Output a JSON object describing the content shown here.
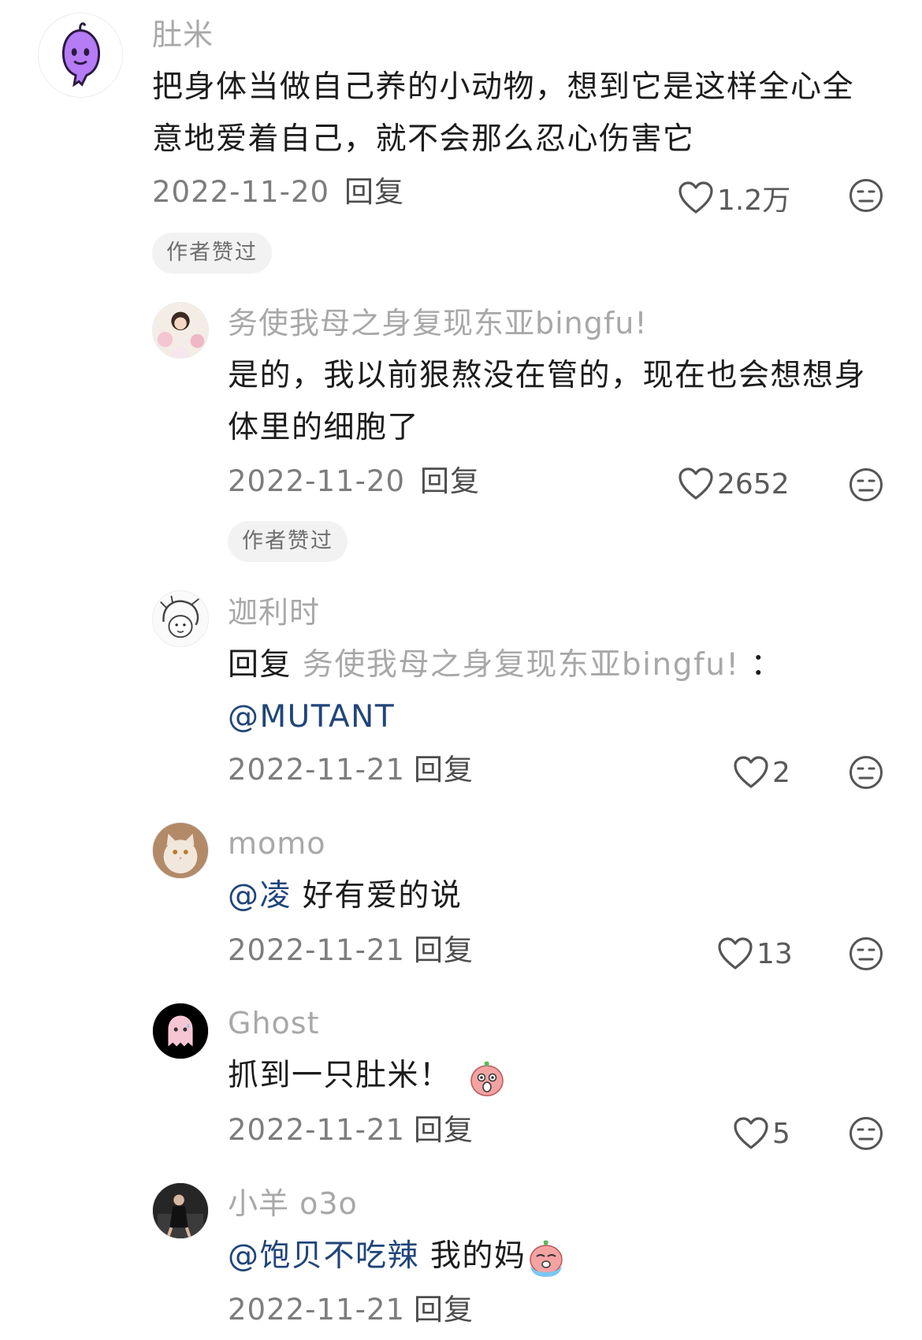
{
  "comments": [
    {
      "username": "肚米",
      "text_lines": [
        "把身体当做自己养的小动物，想到它是这样全心全",
        "意地爱着自己，就不会那么忍心伤害它"
      ],
      "date": "2022-11-20",
      "reply_label": "回复",
      "likes": "1.2万",
      "badge": "作者赞过",
      "avatar_color": "#b57cf5"
    },
    {
      "username": "务使我母之身复现东亚bingfu!",
      "text_lines": [
        "是的，我以前狠熬没在管的，现在也会想想身",
        "体里的细胞了"
      ],
      "date": "2022-11-20",
      "reply_label": "回复",
      "likes": "2652",
      "badge": "作者赞过"
    },
    {
      "username": "迦利时",
      "reply_prefix": "回复",
      "reply_to": "务使我母之身复现东亚bingfu!",
      "reply_colon": "：",
      "mention": "@MUTANT",
      "date": "2022-11-21",
      "reply_label": "回复",
      "likes": "2"
    },
    {
      "username": "momo",
      "mention": "@凌",
      "text": "好有爱的说",
      "date": "2022-11-21",
      "reply_label": "回复",
      "likes": "13"
    },
    {
      "username": "Ghost",
      "text": "抓到一只肚米！",
      "emoji": "surprised-peach-emoji",
      "date": "2022-11-21",
      "reply_label": "回复",
      "likes": "5"
    },
    {
      "username": "小羊 o3o",
      "mention": "@饱贝不吃辣",
      "text": "我的妈",
      "emoji": "crying-peach-emoji",
      "date": "2022-11-21",
      "reply_label": "回复"
    }
  ]
}
